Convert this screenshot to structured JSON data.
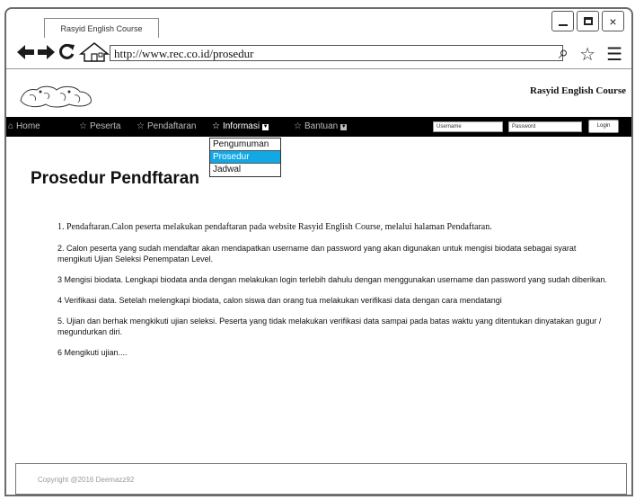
{
  "browser": {
    "tab_title": "Rasyid English Course",
    "url": "http://www.rec.co.id/prosedur",
    "window_buttons": {
      "minimize": "minimize-icon",
      "maximize": "maximize-icon",
      "close": "×"
    },
    "nav_icons": [
      "back-arrow-icon",
      "forward-arrow-icon",
      "reload-icon",
      "home-icon"
    ],
    "right_icons": {
      "search": "⌕",
      "bookmark": "☆",
      "menu": "☰"
    }
  },
  "site": {
    "title": "Rasyid English Course",
    "logo": "sketch-logo"
  },
  "menu": {
    "items": [
      {
        "label": "Home",
        "icon": "⌂"
      },
      {
        "label": "Peserta",
        "icon": "☆"
      },
      {
        "label": "Pendaftaran",
        "icon": "☆"
      },
      {
        "label": "Informasi",
        "icon": "☆"
      },
      {
        "label": "Bantuan",
        "icon": "☆"
      }
    ],
    "username_placeholder": "Username",
    "password_placeholder": "Password",
    "login_label": "Login"
  },
  "dropdown": {
    "items": [
      "Pengumuman",
      "Prosedur",
      "Jadwal"
    ],
    "selected": "Prosedur"
  },
  "page": {
    "title": "Prosedur Pendftaran",
    "steps": [
      "1. Pendaftaran.Calon peserta melakukan pendaftaran pada website Rasyid English Course, melalui halaman Pendaftaran.",
      "2. Calon peserta yang sudah mendaftar akan mendapatkan username dan password yang akan digunakan untuk mengisi biodata sebagai syarat mengikuti Ujian Seleksi Penempatan Level.",
      "3  Mengisi biodata. Lengkapi biodata anda dengan  melakukan login terlebih dahulu dengan menggunakan username dan password yang sudah diberikan.",
      "4  Verifikasi data. Setelah melengkapi biodata, calon siswa dan orang tua melakukan verifikasi data dengan cara mendatangi",
      "5. Ujian dan berhak mengkikuti ujian seleksi. Peserta yang tidak melakukan verifikasi data sampai pada batas waktu yang ditentukan dinyatakan gugur / megundurkan diri.",
      "6  Mengikuti ujian...."
    ]
  },
  "footer": {
    "copyright": "Copyright @2016 Deemazz92"
  }
}
